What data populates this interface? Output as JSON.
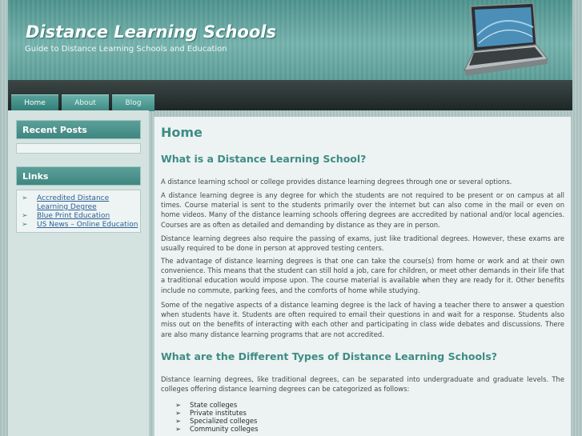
{
  "header": {
    "title": "Distance Learning Schools",
    "tagline": "Guide to Distance Learning Schools and Education"
  },
  "nav": {
    "tabs": [
      "Home",
      "About",
      "Blog"
    ],
    "active": "Home"
  },
  "sidebar": {
    "recent_posts": {
      "heading": "Recent Posts"
    },
    "links": {
      "heading": "Links",
      "items": [
        {
          "label": "Accredited Distance Learning Degree"
        },
        {
          "label": "Blue Print Education"
        },
        {
          "label": "US News – Online Education"
        }
      ]
    }
  },
  "main": {
    "heading": "Home",
    "section1_title": "What is a Distance Learning School?",
    "paragraphs": [
      "A distance learning school or college provides distance learning degrees through one or several options.",
      "A distance learning degree is any degree for which the students are not required to be present or on campus at all times. Course material is sent to the students primarily over the internet but can also come in the mail or even on home videos. Many of the distance learning schools offering degrees are accredited by national and/or local agencies. Courses are as often as detailed and demanding by distance as they are in person.",
      "Distance learning degrees also require the passing of exams, just like traditional degrees. However, these exams are usually required to be done in person at approved testing centers.",
      "The advantage of distance learning degrees is that one can take the course(s) from home or work and at their own convenience. This means that the student can still hold a job, care for children, or meet other demands in their life that a traditional education would impose upon. The course material is available when they are ready for it. Other benefits include no commute, parking fees, and the comforts of home while studying.",
      "Some of the negative aspects of a distance learning degree is the lack of having a teacher there to answer a question when students have it. Students are often required to email their questions in and wait for a response. Students also miss out on the benefits of interacting with each other and participating in class wide debates and discussions. There are also many distance learning programs that are not accredited."
    ],
    "section2_title": "What are the Different Types of Distance Learning Schools?",
    "section2_para": "Distance learning degrees, like traditional degrees, can be separated into undergraduate and graduate levels. The colleges offering distance learning degrees can be categorized as follows:",
    "list": [
      "State colleges",
      "Private institutes",
      "Specialized colleges",
      "Community colleges"
    ]
  },
  "icons": {
    "bullet": "arrow-icon",
    "hero": "laptop-icon"
  },
  "colors": {
    "accent": "#3e8c85",
    "link": "#2b5f97",
    "nav": "#1d2726"
  }
}
